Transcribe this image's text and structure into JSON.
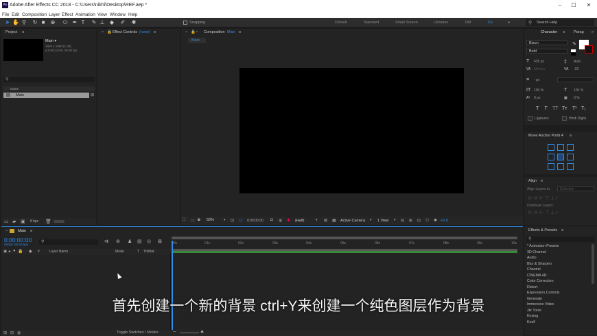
{
  "window": {
    "title": "Adobe After Effects CC 2018 - C:\\Users\\nikhi\\Desktop\\REF.aep *",
    "logo": "Ae"
  },
  "menu": [
    "File",
    "Edit",
    "Composition",
    "Layer",
    "Effect",
    "Animation",
    "View",
    "Window",
    "Help"
  ],
  "toolbar": {
    "snapping": "Snapping",
    "workspaces": [
      "Default",
      "Standard",
      "Small Screen",
      "Libraries",
      "DM",
      "Tut"
    ],
    "active_workspace": "Tut",
    "search_placeholder": "Search Help"
  },
  "project": {
    "tab": "Project",
    "comp_name": "Main ▾",
    "comp_info1": "1920 x 1080 (1.00)",
    "comp_info2": "Δ 0;00;10;00, 30.00 fps",
    "col_name": "Name",
    "item": "Main",
    "bpc": "8 bpc"
  },
  "effect_controls": {
    "tab": "Effect Controls",
    "value": "(none)"
  },
  "composition": {
    "tab": "Composition",
    "name": "Main",
    "sub_tab": "Main",
    "zoom": "50%",
    "timecode": "0:00:00:00",
    "resolution": "(Half)",
    "camera": "Active Camera",
    "views": "1 View",
    "exposure": "+0.0"
  },
  "character": {
    "tab": "Character",
    "tab2": "Parag",
    "font": "Bison",
    "style": "Bold",
    "size": "435 px",
    "leading": "Auto",
    "kerning": "Metrics",
    "tracking": "-20",
    "stroke_unit": "- px",
    "vscale": "100 %",
    "hscale": "100 %",
    "baseline": "0 px",
    "tsume": "0 %",
    "ligatures": "Ligatures",
    "hindi": "Hindi Digits",
    "style_buttons": [
      "T",
      "T",
      "TT",
      "Tт",
      "T¹",
      "T₁"
    ]
  },
  "anchor": {
    "title": "Move Anchor Point 4"
  },
  "align": {
    "title": "Align",
    "align_to_label": "Align Layers to:",
    "align_to_value": "Selection",
    "distribute": "Distribute Layers:"
  },
  "effects": {
    "title": "Effects & Presets",
    "items": [
      "* Animation Presets",
      "3D Channel",
      "Audio",
      "Blur & Sharpen",
      "Channel",
      "CINEMA 4D",
      "Color Correction",
      "Distort",
      "Expression Controls",
      "Generate",
      "Immersive Video",
      "Jkr Tools",
      "Keying",
      "Knoll"
    ]
  },
  "timeline": {
    "tab": "Main",
    "timecode": "0:00:00:00",
    "timecode_sub": "00000 (30.00 fps)",
    "col_layer": "Layer Name",
    "col_mode": "Mode",
    "col_t": "T",
    "col_trkmat": "TrkMat",
    "ticks": [
      "00s",
      "01s",
      "02s",
      "03s",
      "04s",
      "05s",
      "06s",
      "07s",
      "08s",
      "09s",
      "10s"
    ],
    "toggle": "Toggle Switches / Modes"
  },
  "subtitle": "首先创建一个新的背景 ctrl+Y来创建一个纯色图层作为背景"
}
